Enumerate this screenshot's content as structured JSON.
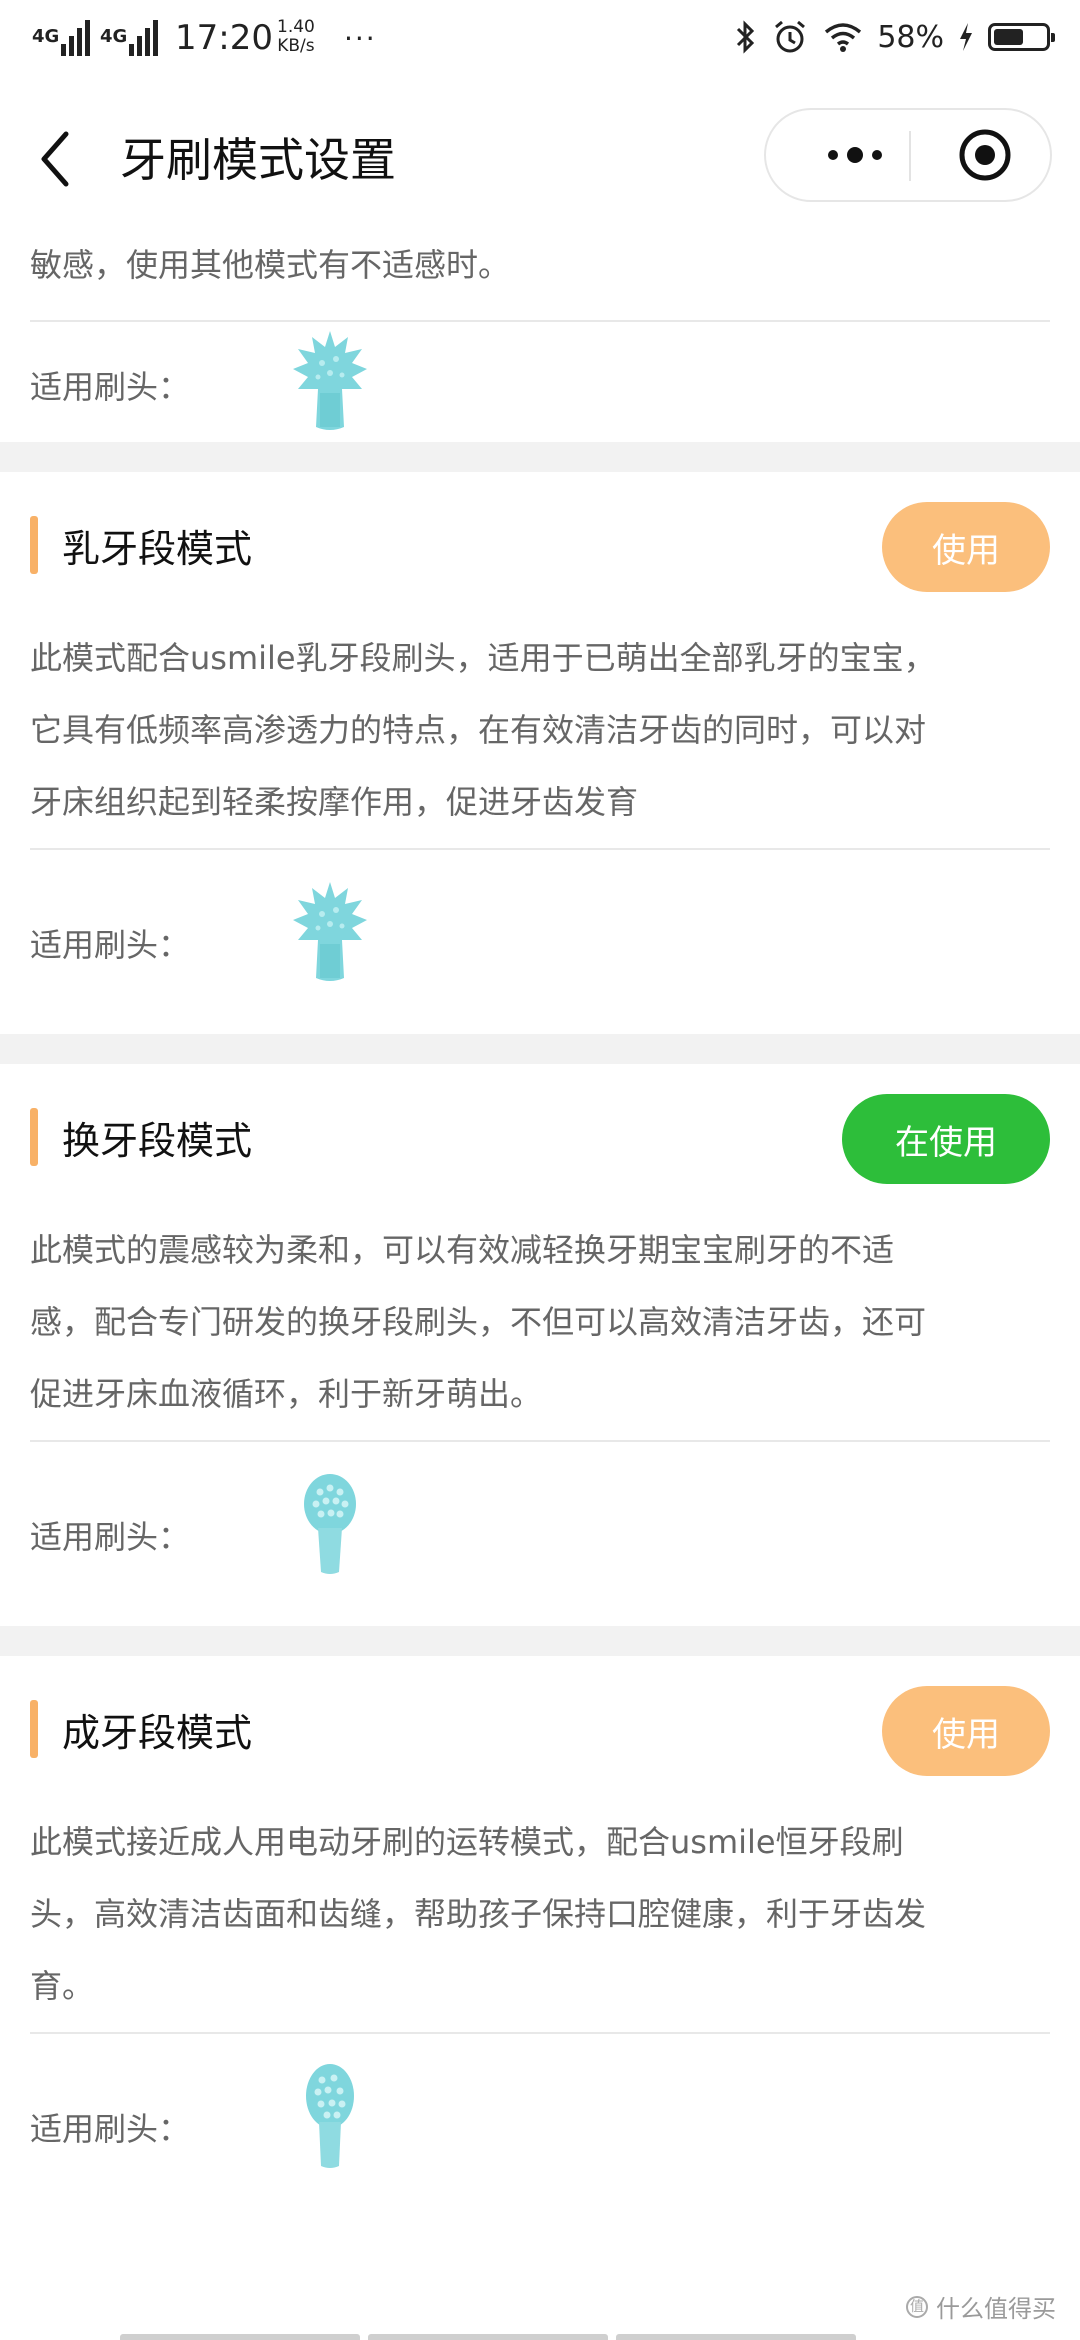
{
  "status_bar": {
    "network_1": "4G",
    "network_2": "4G",
    "time": "17:20",
    "speed_value": "1.40",
    "speed_unit": "KB/s",
    "more": "···",
    "battery_percent": "58%",
    "battery_level": 0.58,
    "icons": [
      "bluetooth-icon",
      "alarm-icon",
      "wifi-icon",
      "charging-icon",
      "battery-icon"
    ]
  },
  "nav": {
    "title": "牙刷模式设置",
    "back_icon": "chevron-left-icon",
    "capsule_icons": [
      "more-dots-icon",
      "target-close-icon"
    ]
  },
  "partial_card": {
    "desc_tail": "敏感，使用其他模式有不适感时。",
    "heads_label": "适用刷头：",
    "brush_icon": "spiky-brush-head-icon"
  },
  "modes": [
    {
      "title": "乳牙段模式",
      "button": "使用",
      "active": false,
      "lines": [
        "此模式配合usmile乳牙段刷头，适用于已萌出全部乳牙的宝宝，",
        "它具有低频率高渗透力的特点，在有效清洁牙齿的同时，可以对",
        "牙床组织起到轻柔按摩作用，促进牙齿发育"
      ],
      "heads_label": "适用刷头：",
      "brush_icon": "spiky-brush-head-icon"
    },
    {
      "title": "换牙段模式",
      "button": "在使用",
      "active": true,
      "lines": [
        "此模式的震感较为柔和，可以有效减轻换牙期宝宝刷牙的不适",
        "感，配合专门研发的换牙段刷头，不但可以高效清洁牙齿，还可",
        "促进牙床血液循环，利于新牙萌出。"
      ],
      "heads_label": "适用刷头：",
      "brush_icon": "round-brush-head-icon"
    },
    {
      "title": "成牙段模式",
      "button": "使用",
      "active": false,
      "lines": [
        "此模式接近成人用电动牙刷的运转模式，配合usmile恒牙段刷",
        "头，高效清洁齿面和齿缝，帮助孩子保持口腔健康，利于牙齿发",
        "育。"
      ],
      "heads_label": "适用刷头：",
      "brush_icon": "round-brush-head-icon"
    }
  ],
  "colors": {
    "accent": "#f8b167",
    "use_button": "#fbbf7c",
    "active_button": "#2dbe3a",
    "brush": "#7fd6dd",
    "page_gap": "#f2f2f2"
  },
  "watermark": "什么值得买"
}
